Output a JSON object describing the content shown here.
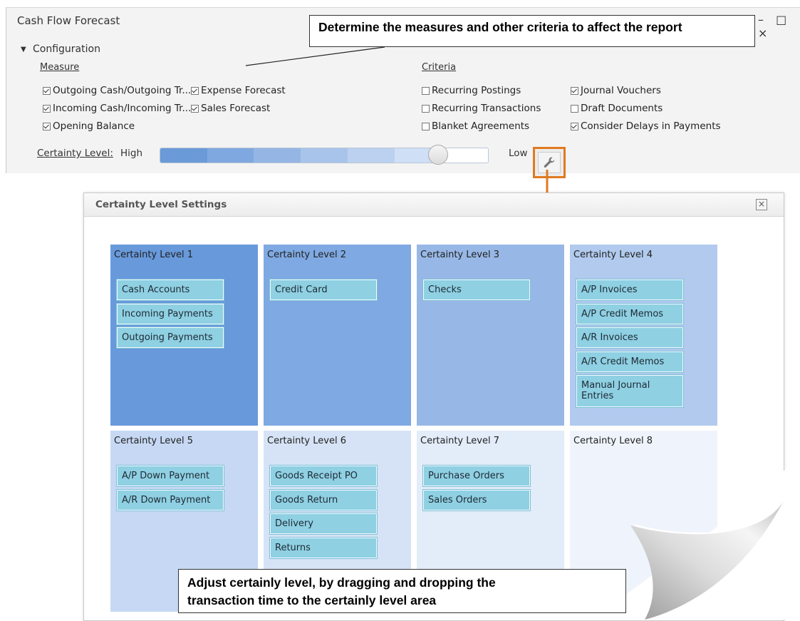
{
  "window": {
    "title": "Cash Flow Forecast",
    "controls": "– □ ×"
  },
  "configuration": {
    "label": "Configuration",
    "measure_title": "Measure",
    "criteria_title": "Criteria",
    "measures": [
      {
        "label": "Outgoing Cash/Outgoing Tr...",
        "checked": true
      },
      {
        "label": "Expense Forecast",
        "checked": true
      },
      {
        "label": "Incoming Cash/Incoming Tr...",
        "checked": true
      },
      {
        "label": "Sales Forecast",
        "checked": true
      },
      {
        "label": "Opening Balance",
        "checked": true
      }
    ],
    "criteria": [
      {
        "label": "Recurring Postings",
        "checked": false
      },
      {
        "label": "Journal Vouchers",
        "checked": true
      },
      {
        "label": "Recurring Transactions",
        "checked": false
      },
      {
        "label": "Draft Documents",
        "checked": false
      },
      {
        "label": "Blanket Agreements",
        "checked": false
      },
      {
        "label": "Consider Delays in Payments",
        "checked": true
      }
    ],
    "certainty": {
      "label": "Certainty Level:",
      "high": "High",
      "low": "Low",
      "level_fraction": 0.85,
      "segment_colors": [
        "#6a9ad8",
        "#80a8e0",
        "#95b6e4",
        "#a9c4ea",
        "#bcd1f0",
        "#cfdff5",
        "#ffffff"
      ]
    }
  },
  "callouts": {
    "top": "Determine the measures and other criteria to affect the report",
    "bottom_line1": "Adjust certainly level, by dragging and dropping the",
    "bottom_line2": "transaction time to the certainly level area"
  },
  "dialog": {
    "title": "Certainty Level Settings",
    "close": "×",
    "levels": [
      {
        "title": "Certainty Level 1",
        "color": "#6899db",
        "items": [
          "Cash Accounts",
          "Incoming Payments",
          "Outgoing Payments"
        ]
      },
      {
        "title": "Certainty Level 2",
        "color": "#7fa9e2",
        "items": [
          "Credit Card"
        ]
      },
      {
        "title": "Certainty Level 3",
        "color": "#97b8e6",
        "items": [
          "Checks"
        ]
      },
      {
        "title": "Certainty Level 4",
        "color": "#b1caee",
        "items": [
          "A/P Invoices",
          "A/P Credit Memos",
          "A/R Invoices",
          "A/R Credit Memos",
          "Manual Journal Entries"
        ]
      },
      {
        "title": "Certainty Level 5",
        "color": "#c6d8f3",
        "items": [
          "A/P Down Payment",
          "A/R Down Payment"
        ]
      },
      {
        "title": "Certainty Level 6",
        "color": "#d6e3f6",
        "items": [
          "Goods Receipt PO",
          "Goods Return",
          "Delivery",
          "Returns"
        ]
      },
      {
        "title": "Certainty Level 7",
        "color": "#e3ecf9",
        "items": [
          "Purchase Orders",
          "Sales Orders"
        ]
      },
      {
        "title": "Certainty Level 8",
        "color": "#eff4fc",
        "items": []
      }
    ]
  },
  "icons": {
    "wrench": "wrench-icon",
    "arrow": "down-arrow-icon"
  }
}
